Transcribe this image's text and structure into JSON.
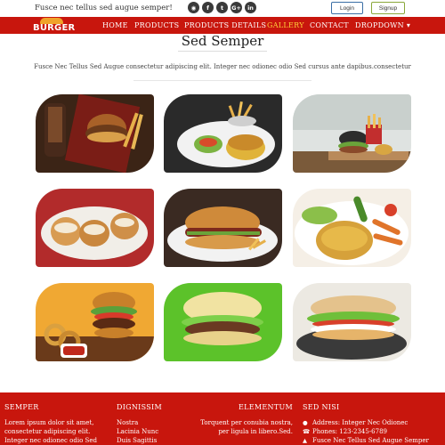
{
  "topbar": {
    "tagline": "Fusce nec tellus sed augue semper!",
    "social": [
      {
        "icon": "rss-icon",
        "glyph": "◉"
      },
      {
        "icon": "facebook-icon",
        "glyph": "f"
      },
      {
        "icon": "twitter-icon",
        "glyph": "t"
      },
      {
        "icon": "google-plus-icon",
        "glyph": "G+"
      },
      {
        "icon": "linkedin-icon",
        "glyph": "in"
      }
    ],
    "login_label": "Login",
    "signup_label": "Signup"
  },
  "navbar": {
    "logo_text": "BURGER",
    "items": [
      {
        "label": "HOME",
        "active": false
      },
      {
        "label": "PRODUCTS",
        "active": false
      },
      {
        "label": "PRODUCTS DETAILS",
        "active": false
      },
      {
        "label": "GALLERY",
        "active": true
      },
      {
        "label": "CONTACT",
        "active": false
      },
      {
        "label": "DROPDOWN ▾",
        "active": false
      }
    ],
    "background": "#c8160d",
    "active_color": "#ffd23a"
  },
  "main": {
    "title": "Sed Semper",
    "subtitle": "Fusce Nec Tellus Sed Augue consectetur adipiscing elit. Integer nec odionec odio Sed cursus ante dapibus.consectetur"
  },
  "gallery": {
    "images": [
      "burger-with-fries-on-tray",
      "burger-and-fries-on-plate",
      "burger-fries-on-board",
      "sandwiches-in-basket",
      "hotdog-on-plate",
      "burger-with-vegetables",
      "burger-with-onion-rings-and-ketchup",
      "burger-on-green-background",
      "burger-on-dark-plate"
    ]
  },
  "footer": {
    "col1": {
      "heading": "SEMPER",
      "text": "Lorem ipsum dolor sit amet, consectetur adipiscing elit. Integer nec odionec odio Sed cursus ante"
    },
    "col2": {
      "heading": "DIGNISSIM",
      "links": [
        "Nostra",
        "Lacinia Nunc",
        "Duis Sagittis"
      ]
    },
    "col3": {
      "heading": "ELEMENTUM",
      "text": "Torquent per conubia nostra, per ligula in libero.Sed."
    },
    "col4": {
      "heading": "SED NISI",
      "items": [
        {
          "icon": "map-marker-icon",
          "glyph": "●",
          "text": "Address: Integer Nec Odionec"
        },
        {
          "icon": "phone-icon",
          "glyph": "☎",
          "text": "Phones: 123-2345-6789"
        },
        {
          "icon": "user-icon",
          "glyph": "▲",
          "text": "Fusce Nec Tellus Sed Augue Semper"
        }
      ]
    }
  }
}
